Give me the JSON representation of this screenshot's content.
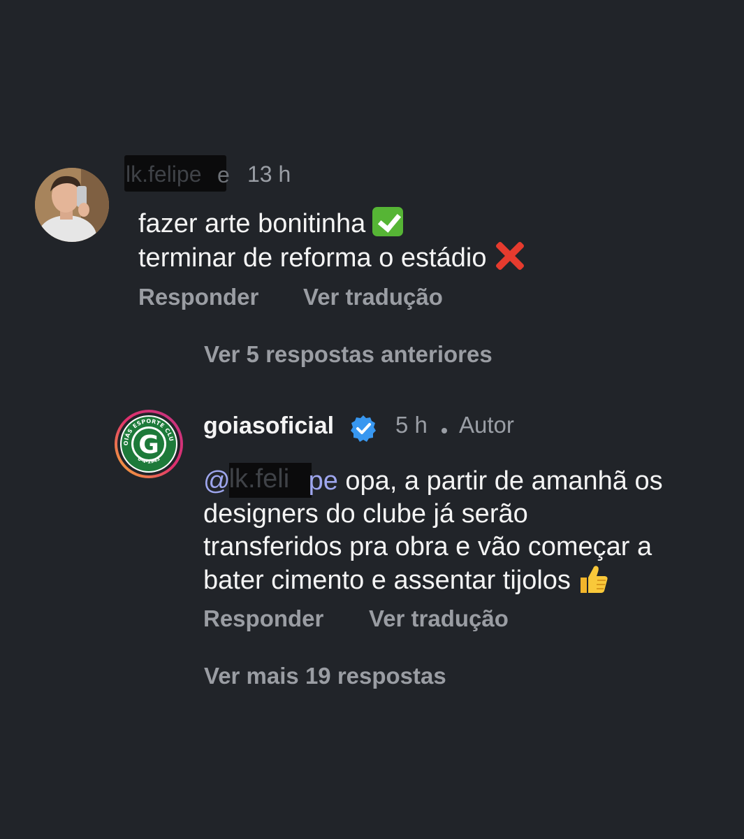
{
  "comment": {
    "username": "lk.felipe",
    "username_tail": "e",
    "time": "13 h",
    "line1": "fazer arte bonitinha",
    "line1_emoji": "check-mark-emoji",
    "line2": "terminar de reforma o estádio",
    "line2_emoji": "cross-mark-emoji",
    "reply_label": "Responder",
    "translate_label": "Ver tradução"
  },
  "view_previous_label": "Ver 5 respostas anteriores",
  "reply": {
    "username": "goiasoficial",
    "verified_icon": "verified-badge-icon",
    "time": "5 h",
    "author_label": "Autor",
    "mention_at": "@",
    "mention_name": "lk.feli",
    "mention_tail": "pe",
    "text_line1": " opa, a partir de amanhã os",
    "text_line2": "designers do clube já serão",
    "text_line3": "transferidos pra obra e vão começar a",
    "text_line4": "bater cimento e assentar tijolos",
    "end_emoji": "thumbs-up-emoji",
    "reply_label": "Responder",
    "translate_label": "Ver tradução",
    "avatar_logo": {
      "arc_text": "GOIÁS ESPORTE CLUBE",
      "founding_date": "6-4-1943",
      "letter": "G"
    }
  },
  "view_more_label": "Ver mais 19 respostas",
  "colors": {
    "background": "#212429",
    "text": "#f4f4f4",
    "muted": "#9a9da3",
    "mention": "#9ea6ee",
    "verified": "#3897f0",
    "club_green": "#1d7a3a"
  }
}
